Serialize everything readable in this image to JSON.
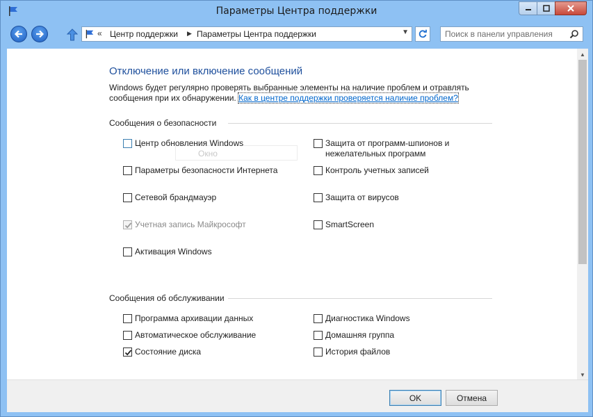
{
  "window": {
    "title": "Параметры Центра поддержки"
  },
  "nav": {
    "breadcrumb": [
      "Центр поддержки",
      "Параметры Центра поддержки"
    ],
    "search_placeholder": "Поиск в панели управления"
  },
  "content": {
    "heading": "Отключение или включение сообщений",
    "description": "Windows будет регулярно проверять выбранные элементы на наличие проблем и отравлять сообщения при их обнаружении.",
    "help_link": "Как в центре поддержки проверяется наличие проблем?",
    "ghost_text": "Окно",
    "security": {
      "title": "Сообщения о безопасности",
      "left": [
        {
          "label": "Центр обновления Windows",
          "checked": false
        },
        {
          "label": "Параметры безопасности Интернета",
          "checked": false
        },
        {
          "label": "Сетевой брандмауэр",
          "checked": false
        },
        {
          "label": "Учетная запись Майкрософт",
          "checked": true,
          "disabled": true
        },
        {
          "label": "Активация Windows",
          "checked": false
        }
      ],
      "right": [
        {
          "label": "Защита от программ-шпионов и нежелательных программ",
          "checked": false
        },
        {
          "label": "Контроль учетных записей",
          "checked": false
        },
        {
          "label": "Защита от вирусов",
          "checked": false
        },
        {
          "label": "SmartScreen",
          "checked": false
        }
      ]
    },
    "maintenance": {
      "title": "Сообщения об обслуживании",
      "left": [
        {
          "label": "Программа архивации данных",
          "checked": false
        },
        {
          "label": "Автоматическое обслуживание",
          "checked": false
        },
        {
          "label": "Состояние диска",
          "checked": true
        }
      ],
      "right": [
        {
          "label": "Диагностика Windows",
          "checked": false
        },
        {
          "label": "Домашняя группа",
          "checked": false
        },
        {
          "label": "История файлов",
          "checked": false
        }
      ]
    }
  },
  "footer": {
    "ok_label": "OK",
    "cancel_label": "Отмена"
  },
  "colors": {
    "heading": "#1e4f9c",
    "link": "#0066cc",
    "frame": "#8ec1f3"
  }
}
